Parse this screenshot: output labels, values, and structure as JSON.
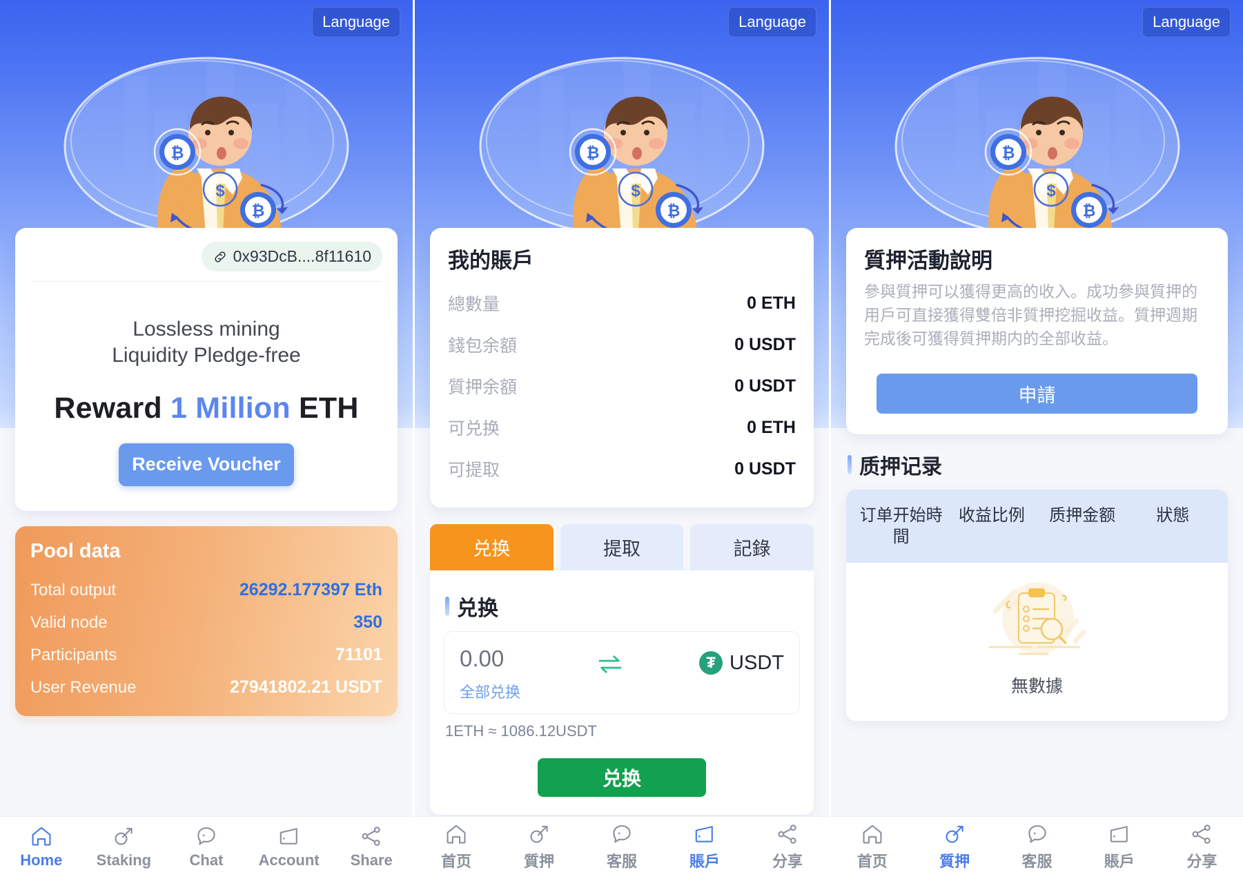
{
  "panels": [
    {
      "id": "home",
      "lang_button": "Language",
      "wallet": {
        "icon": "link-icon",
        "address": "0x93DcB....8f11610"
      },
      "slogan_line1": "Lossless mining",
      "slogan_line2": "Liquidity Pledge-free",
      "reward": {
        "pre": "Reward",
        "highlight": "1 Million",
        "post": "ETH"
      },
      "cta": "Receive Voucher",
      "pool": {
        "title": "Pool data",
        "rows": [
          {
            "label": "Total output",
            "value": "26292.177397 Eth",
            "accent": "blue"
          },
          {
            "label": "Valid node",
            "value": "350",
            "accent": "blue"
          },
          {
            "label": "Participants",
            "value": "71101",
            "accent": "white"
          },
          {
            "label": "User Revenue",
            "value": "27941802.21 USDT",
            "accent": "white"
          }
        ]
      },
      "nav": [
        {
          "icon": "home-icon",
          "label": "Home",
          "active": true
        },
        {
          "icon": "pickaxe-icon",
          "label": "Staking",
          "active": false
        },
        {
          "icon": "chat-icon",
          "label": "Chat",
          "active": false
        },
        {
          "icon": "wallet-icon",
          "label": "Account",
          "active": false
        },
        {
          "icon": "share-icon",
          "label": "Share",
          "active": false
        }
      ]
    },
    {
      "id": "account",
      "lang_button": "Language",
      "account": {
        "title": "我的賬戶",
        "rows": [
          {
            "label": "總數量",
            "value": "0 ETH"
          },
          {
            "label": "錢包余額",
            "value": "0 USDT"
          },
          {
            "label": "質押余額",
            "value": "0 USDT"
          },
          {
            "label": "可兑换",
            "value": "0 ETH"
          },
          {
            "label": "可提取",
            "value": "0 USDT"
          }
        ]
      },
      "tabs": [
        {
          "label": "兑换",
          "active": true
        },
        {
          "label": "提取",
          "active": false
        },
        {
          "label": "記錄",
          "active": false
        }
      ],
      "exchange": {
        "section_title": "兑换",
        "amount": "0.00",
        "amount_placeholder": "0.00",
        "all_link": "全部兑换",
        "swap_icon": "swap-arrows-icon",
        "token_icon": "usdt-icon",
        "token_glyph": "₮",
        "token_symbol": "USDT",
        "rate": "1ETH ≈ 1086.12USDT",
        "submit": "兑换"
      },
      "nav": [
        {
          "icon": "home-icon",
          "label": "首页",
          "active": false
        },
        {
          "icon": "pickaxe-icon",
          "label": "質押",
          "active": false
        },
        {
          "icon": "chat-icon",
          "label": "客服",
          "active": false
        },
        {
          "icon": "wallet-icon",
          "label": "賬戶",
          "active": true
        },
        {
          "icon": "share-icon",
          "label": "分享",
          "active": false
        }
      ]
    },
    {
      "id": "staking",
      "lang_button": "Language",
      "stake_info": {
        "title": "質押活動說明",
        "body": "參與質押可以獲得更高的收入。成功參與質押的用戶可直接獲得雙倍非質押挖掘收益。質押週期完成後可獲得質押期内的全部收益。",
        "apply": "申請"
      },
      "records": {
        "section_title": "质押记录",
        "columns": [
          "订单开始時間",
          "收益比例",
          "质押金额",
          "狀態"
        ],
        "rows": [],
        "empty_text": "無數據",
        "empty_icon": "no-data-clipboard-icon"
      },
      "nav": [
        {
          "icon": "home-icon",
          "label": "首页",
          "active": false
        },
        {
          "icon": "pickaxe-icon",
          "label": "質押",
          "active": true
        },
        {
          "icon": "chat-icon",
          "label": "客服",
          "active": false
        },
        {
          "icon": "wallet-icon",
          "label": "賬戶",
          "active": false
        },
        {
          "icon": "share-icon",
          "label": "分享",
          "active": false
        }
      ]
    }
  ],
  "colors": {
    "hero_top": "#3b63ef",
    "hero_bottom": "#d9e5fe",
    "accent_blue": "#6a9aec",
    "active_nav": "#4a7ced",
    "tab_active_orange": "#f7941d",
    "submit_green": "#12a150",
    "pool_gradient_from": "#f09a5a",
    "pool_gradient_to": "#fbd5ab",
    "pool_value_blue": "#2f6fe0"
  }
}
